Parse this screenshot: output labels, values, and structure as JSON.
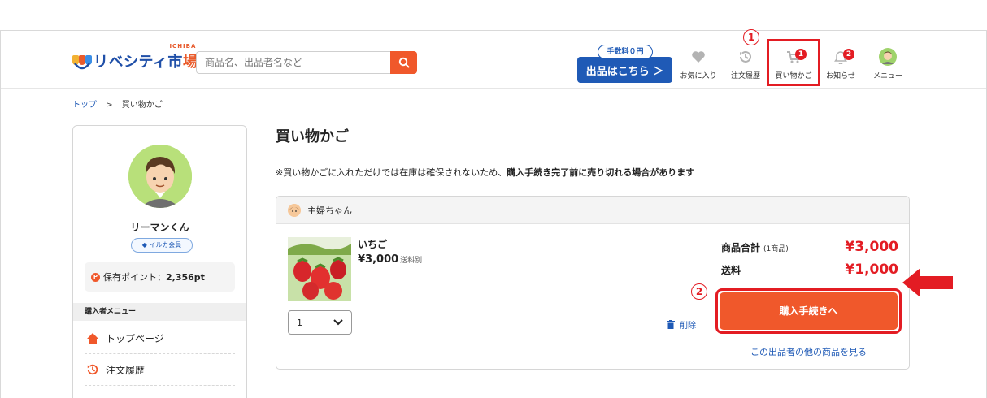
{
  "header": {
    "logo_text": "リベシティ市",
    "logo_text2": "場",
    "logo_sub": "ICHIBA",
    "search_placeholder": "商品名、出品者名など",
    "fee_badge": "手数料０円",
    "sell_label": "出品はこちら ＞",
    "nav": {
      "favorites": "お気に入り",
      "orders": "注文履歴",
      "cart": "買い物かご",
      "cart_count": "1",
      "notifications": "お知らせ",
      "notif_count": "2",
      "menu": "メニュー"
    }
  },
  "annotations": {
    "one": "1",
    "two": "2"
  },
  "breadcrumb": {
    "home": "トップ",
    "sep": ">",
    "current": "買い物かご"
  },
  "sidebar": {
    "user_name": "リーマンくん",
    "member_badge": "イルカ会員",
    "points_label": "保有ポイント：",
    "points_value": "2,356pt",
    "menu_title": "購入者メニュー",
    "links": [
      "トップページ",
      "注文履歴"
    ]
  },
  "main": {
    "title": "買い物かご",
    "notice_plain": "※買い物かごに入れただけでは在庫は確保されないため、",
    "notice_bold": "購入手続き完了前に売り切れる場合があります",
    "seller_name": "主婦ちゃん",
    "product": {
      "name": "いちご",
      "price": "¥3,000",
      "shipping_note": "送料別",
      "qty": "1"
    },
    "delete_label": "削除",
    "subtotal_label": "商品合計",
    "subtotal_count": "(1商品)",
    "subtotal_value": "¥3,000",
    "shipping_label": "送料",
    "shipping_value": "¥1,000",
    "checkout_label": "購入手続きへ",
    "more_link": "この出品者の他の商品を見る"
  },
  "colors": {
    "accent": "#f0582b",
    "brand_blue": "#1f5ab6",
    "alert_red": "#e31c23"
  }
}
